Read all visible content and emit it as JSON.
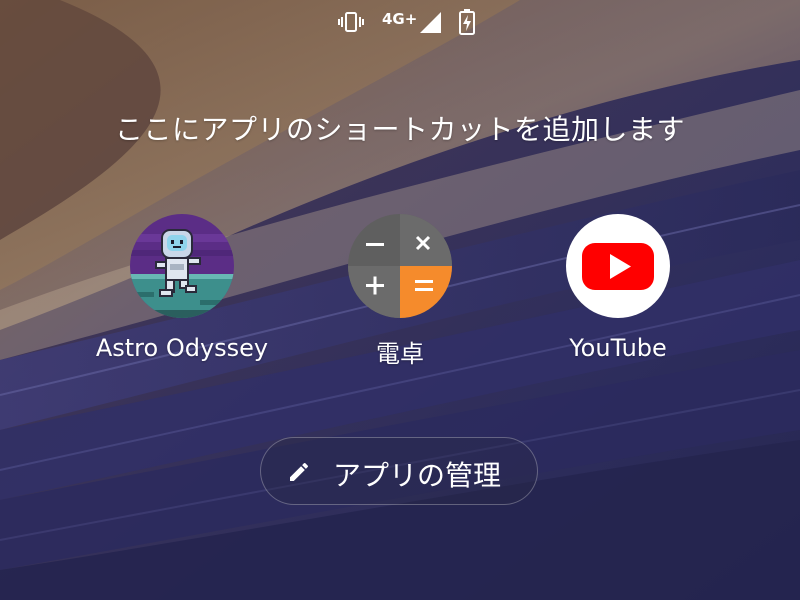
{
  "status_bar": {
    "vibrate_icon": "vibrate-icon",
    "network_type": "4G+",
    "signal_icon": "cellular-signal-icon",
    "battery_icon": "battery-charging-icon"
  },
  "heading": "ここにアプリのショートカットを追加します",
  "shortcuts": [
    {
      "label": "Astro Odyssey",
      "icon": "astronaut-game-icon"
    },
    {
      "label": "電卓",
      "icon": "calculator-icon"
    },
    {
      "label": "YouTube",
      "icon": "youtube-icon"
    }
  ],
  "manage_button": {
    "label": "アプリの管理",
    "icon": "pencil-icon"
  },
  "colors": {
    "calculator_gray": "#5f5f5f",
    "calculator_orange": "#f58b2c",
    "youtube_red": "#ff0000",
    "astro_purple": "#5b2d86",
    "astro_teal": "#3d8f8c",
    "text": "#ffffff"
  }
}
